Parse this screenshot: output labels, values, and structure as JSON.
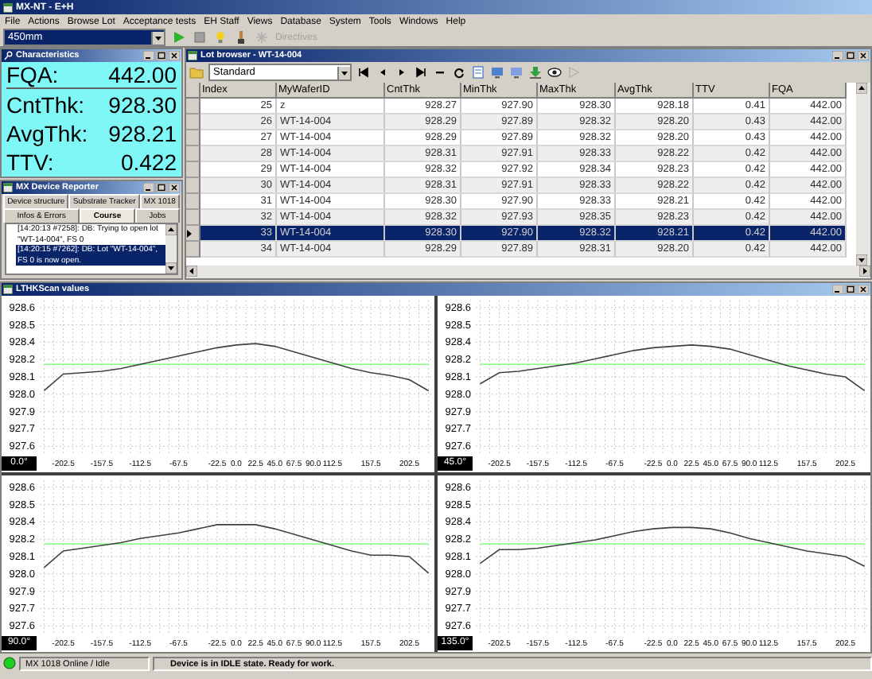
{
  "window": {
    "title": "MX-NT - E+H"
  },
  "menu": [
    "File",
    "Actions",
    "Browse Lot",
    "Acceptance tests",
    "EH Staff",
    "Views",
    "Database",
    "System",
    "Tools",
    "Windows",
    "Help"
  ],
  "toolbar": {
    "wafer_size": "450mm",
    "directives": "Directives"
  },
  "characteristics": {
    "title": "Characteristics",
    "values": [
      {
        "label": "FQA:",
        "value": "442.00"
      },
      {
        "label": "CntThk:",
        "value": "928.30"
      },
      {
        "label": "AvgThk:",
        "value": "928.21"
      },
      {
        "label": "TTV:",
        "value": "0.422"
      }
    ]
  },
  "device_reporter": {
    "title": "MX Device Reporter",
    "tab_rows": [
      [
        {
          "label": "Device structure",
          "selected": false
        },
        {
          "label": "Substrate Tracker",
          "selected": false
        },
        {
          "label": "MX 1018",
          "selected": false
        }
      ],
      [
        {
          "label": "Infos & Errors",
          "selected": false
        },
        {
          "label": "Course",
          "selected": true
        },
        {
          "label": "Jobs",
          "selected": false
        }
      ]
    ],
    "log": [
      {
        "text": "[14:20:13  #7258]: DB: Trying to open lot \"WT-14-004\", FS 0",
        "selected": false
      },
      {
        "text": "[14:20:15  #7262]: DB: Lot \"WT-14-004\", FS 0 is now open.",
        "selected": true
      }
    ]
  },
  "lot_browser": {
    "title": "Lot browser - WT-14-004",
    "view": "Standard",
    "columns": [
      "Index",
      "MyWaferID",
      "CntThk",
      "MinThk",
      "MaxThk",
      "AvgThk",
      "TTV",
      "FQA"
    ],
    "rows": [
      {
        "cells": [
          "25",
          "z",
          "928.27",
          "927.90",
          "928.30",
          "928.18",
          "0.41",
          "442.00"
        ],
        "selected": false
      },
      {
        "cells": [
          "26",
          "WT-14-004",
          "928.29",
          "927.89",
          "928.32",
          "928.20",
          "0.43",
          "442.00"
        ],
        "selected": false
      },
      {
        "cells": [
          "27",
          "WT-14-004",
          "928.29",
          "927.89",
          "928.32",
          "928.20",
          "0.43",
          "442.00"
        ],
        "selected": false
      },
      {
        "cells": [
          "28",
          "WT-14-004",
          "928.31",
          "927.91",
          "928.33",
          "928.22",
          "0.42",
          "442.00"
        ],
        "selected": false
      },
      {
        "cells": [
          "29",
          "WT-14-004",
          "928.32",
          "927.92",
          "928.34",
          "928.23",
          "0.42",
          "442.00"
        ],
        "selected": false
      },
      {
        "cells": [
          "30",
          "WT-14-004",
          "928.31",
          "927.91",
          "928.33",
          "928.22",
          "0.42",
          "442.00"
        ],
        "selected": false
      },
      {
        "cells": [
          "31",
          "WT-14-004",
          "928.30",
          "927.90",
          "928.33",
          "928.21",
          "0.42",
          "442.00"
        ],
        "selected": false
      },
      {
        "cells": [
          "32",
          "WT-14-004",
          "928.32",
          "927.93",
          "928.35",
          "928.23",
          "0.42",
          "442.00"
        ],
        "selected": false
      },
      {
        "cells": [
          "33",
          "WT-14-004",
          "928.30",
          "927.90",
          "928.32",
          "928.21",
          "0.42",
          "442.00"
        ],
        "selected": true
      },
      {
        "cells": [
          "34",
          "WT-14-004",
          "928.29",
          "927.89",
          "928.31",
          "928.20",
          "0.42",
          "442.00"
        ],
        "selected": false
      }
    ]
  },
  "scan": {
    "title": "LTHKScan values",
    "charts": [
      {
        "angle": "0.0°",
        "chart_data": {
          "type": "line",
          "x": [
            -225,
            -202.5,
            -180,
            -157.5,
            -135,
            -112.5,
            -90,
            -67.5,
            -45,
            -22.5,
            0,
            22.5,
            45,
            67.5,
            90,
            112.5,
            135,
            157.5,
            180,
            202.5,
            225
          ],
          "series": [
            {
              "color": "#80ff80",
              "values": [
                928.19,
                928.19,
                928.19,
                928.19,
                928.19,
                928.19,
                928.19,
                928.19,
                928.19,
                928.19,
                928.19,
                928.19,
                928.19,
                928.19,
                928.19,
                928.19,
                928.19,
                928.19,
                928.19,
                928.19,
                928.19
              ]
            },
            {
              "color": "#404040",
              "values": [
                928.0,
                928.12,
                928.13,
                928.14,
                928.16,
                928.19,
                928.22,
                928.25,
                928.28,
                928.31,
                928.33,
                928.34,
                928.32,
                928.28,
                928.24,
                928.2,
                928.16,
                928.13,
                928.11,
                928.08,
                928.0
              ]
            }
          ],
          "xlim": [
            -230,
            230
          ],
          "ylim": [
            927.55,
            928.65
          ],
          "xticks": [
            {
              "value": -202.5,
              "label": "-202.5"
            },
            {
              "value": -157.5,
              "label": "-157.5"
            },
            {
              "value": -112.5,
              "label": "-112.5"
            },
            {
              "value": -67.5,
              "label": "-67.5"
            },
            {
              "value": -22.5,
              "label": "-22.5"
            },
            {
              "value": 0,
              "label": "0.0"
            },
            {
              "value": 22.5,
              "label": "22.5"
            },
            {
              "value": 45,
              "label": "45.0"
            },
            {
              "value": 67.5,
              "label": "67.5"
            },
            {
              "value": 90,
              "label": "90.0"
            },
            {
              "value": 112.5,
              "label": "112.5"
            },
            {
              "value": 157.5,
              "label": "157.5"
            },
            {
              "value": 202.5,
              "label": "202.5"
            }
          ],
          "yticks": [
            {
              "value": 928.6,
              "label": "928.6"
            },
            {
              "value": 928.475,
              "label": "928.5"
            },
            {
              "value": 928.35,
              "label": "928.4"
            },
            {
              "value": 928.225,
              "label": "928.2"
            },
            {
              "value": 928.1,
              "label": "928.1"
            },
            {
              "value": 927.975,
              "label": "928.0"
            },
            {
              "value": 927.85,
              "label": "927.9"
            },
            {
              "value": 927.725,
              "label": "927.7"
            },
            {
              "value": 927.6,
              "label": "927.6"
            }
          ],
          "grid": true
        }
      },
      {
        "angle": "45.0°",
        "chart_data": {
          "type": "line",
          "x": [
            -225,
            -202.5,
            -180,
            -157.5,
            -135,
            -112.5,
            -90,
            -67.5,
            -45,
            -22.5,
            0,
            22.5,
            45,
            67.5,
            90,
            112.5,
            135,
            157.5,
            180,
            202.5,
            225
          ],
          "series": [
            {
              "color": "#80ff80",
              "values": [
                928.19,
                928.19,
                928.19,
                928.19,
                928.19,
                928.19,
                928.19,
                928.19,
                928.19,
                928.19,
                928.19,
                928.19,
                928.19,
                928.19,
                928.19,
                928.19,
                928.19,
                928.19,
                928.19,
                928.19,
                928.19
              ]
            },
            {
              "color": "#404040",
              "values": [
                928.05,
                928.13,
                928.14,
                928.16,
                928.18,
                928.2,
                928.23,
                928.26,
                928.29,
                928.31,
                928.32,
                928.33,
                928.32,
                928.3,
                928.26,
                928.22,
                928.18,
                928.15,
                928.12,
                928.1,
                928.0
              ]
            }
          ],
          "xlim": [
            -230,
            230
          ],
          "ylim": [
            927.55,
            928.65
          ],
          "xticks": [
            {
              "value": -202.5,
              "label": "-202.5"
            },
            {
              "value": -157.5,
              "label": "-157.5"
            },
            {
              "value": -112.5,
              "label": "-112.5"
            },
            {
              "value": -67.5,
              "label": "-67.5"
            },
            {
              "value": -22.5,
              "label": "-22.5"
            },
            {
              "value": 0,
              "label": "0.0"
            },
            {
              "value": 22.5,
              "label": "22.5"
            },
            {
              "value": 45,
              "label": "45.0"
            },
            {
              "value": 67.5,
              "label": "67.5"
            },
            {
              "value": 90,
              "label": "90.0"
            },
            {
              "value": 112.5,
              "label": "112.5"
            },
            {
              "value": 157.5,
              "label": "157.5"
            },
            {
              "value": 202.5,
              "label": "202.5"
            }
          ],
          "yticks": [
            {
              "value": 928.6,
              "label": "928.6"
            },
            {
              "value": 928.475,
              "label": "928.5"
            },
            {
              "value": 928.35,
              "label": "928.4"
            },
            {
              "value": 928.225,
              "label": "928.2"
            },
            {
              "value": 928.1,
              "label": "928.1"
            },
            {
              "value": 927.975,
              "label": "928.0"
            },
            {
              "value": 927.85,
              "label": "927.9"
            },
            {
              "value": 927.725,
              "label": "927.7"
            },
            {
              "value": 927.6,
              "label": "927.6"
            }
          ],
          "grid": true
        }
      },
      {
        "angle": "90.0°",
        "chart_data": {
          "type": "line",
          "x": [
            -225,
            -202.5,
            -180,
            -157.5,
            -135,
            -112.5,
            -90,
            -67.5,
            -45,
            -22.5,
            0,
            22.5,
            45,
            67.5,
            90,
            112.5,
            135,
            157.5,
            180,
            202.5,
            225
          ],
          "series": [
            {
              "color": "#80ff80",
              "values": [
                928.19,
                928.19,
                928.19,
                928.19,
                928.19,
                928.19,
                928.19,
                928.19,
                928.19,
                928.19,
                928.19,
                928.19,
                928.19,
                928.19,
                928.19,
                928.19,
                928.19,
                928.19,
                928.19,
                928.19,
                928.19
              ]
            },
            {
              "color": "#404040",
              "values": [
                928.02,
                928.14,
                928.16,
                928.18,
                928.2,
                928.23,
                928.25,
                928.27,
                928.3,
                928.33,
                928.33,
                928.33,
                928.3,
                928.26,
                928.22,
                928.18,
                928.14,
                928.11,
                928.11,
                928.1,
                927.98
              ]
            }
          ],
          "xlim": [
            -230,
            230
          ],
          "ylim": [
            927.55,
            928.65
          ],
          "xticks": [
            {
              "value": -202.5,
              "label": "-202.5"
            },
            {
              "value": -157.5,
              "label": "-157.5"
            },
            {
              "value": -112.5,
              "label": "-112.5"
            },
            {
              "value": -67.5,
              "label": "-67.5"
            },
            {
              "value": -22.5,
              "label": "-22.5"
            },
            {
              "value": 0,
              "label": "0.0"
            },
            {
              "value": 22.5,
              "label": "22.5"
            },
            {
              "value": 45,
              "label": "45.0"
            },
            {
              "value": 67.5,
              "label": "67.5"
            },
            {
              "value": 90,
              "label": "90.0"
            },
            {
              "value": 112.5,
              "label": "112.5"
            },
            {
              "value": 157.5,
              "label": "157.5"
            },
            {
              "value": 202.5,
              "label": "202.5"
            }
          ],
          "yticks": [
            {
              "value": 928.6,
              "label": "928.6"
            },
            {
              "value": 928.475,
              "label": "928.5"
            },
            {
              "value": 928.35,
              "label": "928.4"
            },
            {
              "value": 928.225,
              "label": "928.2"
            },
            {
              "value": 928.1,
              "label": "928.1"
            },
            {
              "value": 927.975,
              "label": "928.0"
            },
            {
              "value": 927.85,
              "label": "927.9"
            },
            {
              "value": 927.725,
              "label": "927.7"
            },
            {
              "value": 927.6,
              "label": "927.6"
            }
          ],
          "grid": true
        }
      },
      {
        "angle": "135.0°",
        "chart_data": {
          "type": "line",
          "x": [
            -225,
            -202.5,
            -180,
            -157.5,
            -135,
            -112.5,
            -90,
            -67.5,
            -45,
            -22.5,
            0,
            22.5,
            45,
            67.5,
            90,
            112.5,
            135,
            157.5,
            180,
            202.5,
            225
          ],
          "series": [
            {
              "color": "#80ff80",
              "values": [
                928.19,
                928.19,
                928.19,
                928.19,
                928.19,
                928.19,
                928.19,
                928.19,
                928.19,
                928.19,
                928.19,
                928.19,
                928.19,
                928.19,
                928.19,
                928.19,
                928.19,
                928.19,
                928.19,
                928.19,
                928.19
              ]
            },
            {
              "color": "#404040",
              "values": [
                928.05,
                928.15,
                928.15,
                928.16,
                928.18,
                928.2,
                928.22,
                928.25,
                928.28,
                928.3,
                928.31,
                928.31,
                928.3,
                928.27,
                928.23,
                928.2,
                928.17,
                928.14,
                928.12,
                928.1,
                928.03
              ]
            }
          ],
          "xlim": [
            -230,
            230
          ],
          "ylim": [
            927.55,
            928.65
          ],
          "xticks": [
            {
              "value": -202.5,
              "label": "-202.5"
            },
            {
              "value": -157.5,
              "label": "-157.5"
            },
            {
              "value": -112.5,
              "label": "-112.5"
            },
            {
              "value": -67.5,
              "label": "-67.5"
            },
            {
              "value": -22.5,
              "label": "-22.5"
            },
            {
              "value": 0,
              "label": "0.0"
            },
            {
              "value": 22.5,
              "label": "22.5"
            },
            {
              "value": 45,
              "label": "45.0"
            },
            {
              "value": 67.5,
              "label": "67.5"
            },
            {
              "value": 90,
              "label": "90.0"
            },
            {
              "value": 112.5,
              "label": "112.5"
            },
            {
              "value": 157.5,
              "label": "157.5"
            },
            {
              "value": 202.5,
              "label": "202.5"
            }
          ],
          "yticks": [
            {
              "value": 928.6,
              "label": "928.6"
            },
            {
              "value": 928.475,
              "label": "928.5"
            },
            {
              "value": 928.35,
              "label": "928.4"
            },
            {
              "value": 928.225,
              "label": "928.2"
            },
            {
              "value": 928.1,
              "label": "928.1"
            },
            {
              "value": 927.975,
              "label": "928.0"
            },
            {
              "value": 927.85,
              "label": "927.9"
            },
            {
              "value": 927.725,
              "label": "927.7"
            },
            {
              "value": 927.6,
              "label": "927.6"
            }
          ],
          "grid": true
        }
      }
    ]
  },
  "status_bar": {
    "online": true,
    "connection": "MX 1018 Online / Idle",
    "message": "Device is in IDLE state. Ready for work."
  }
}
